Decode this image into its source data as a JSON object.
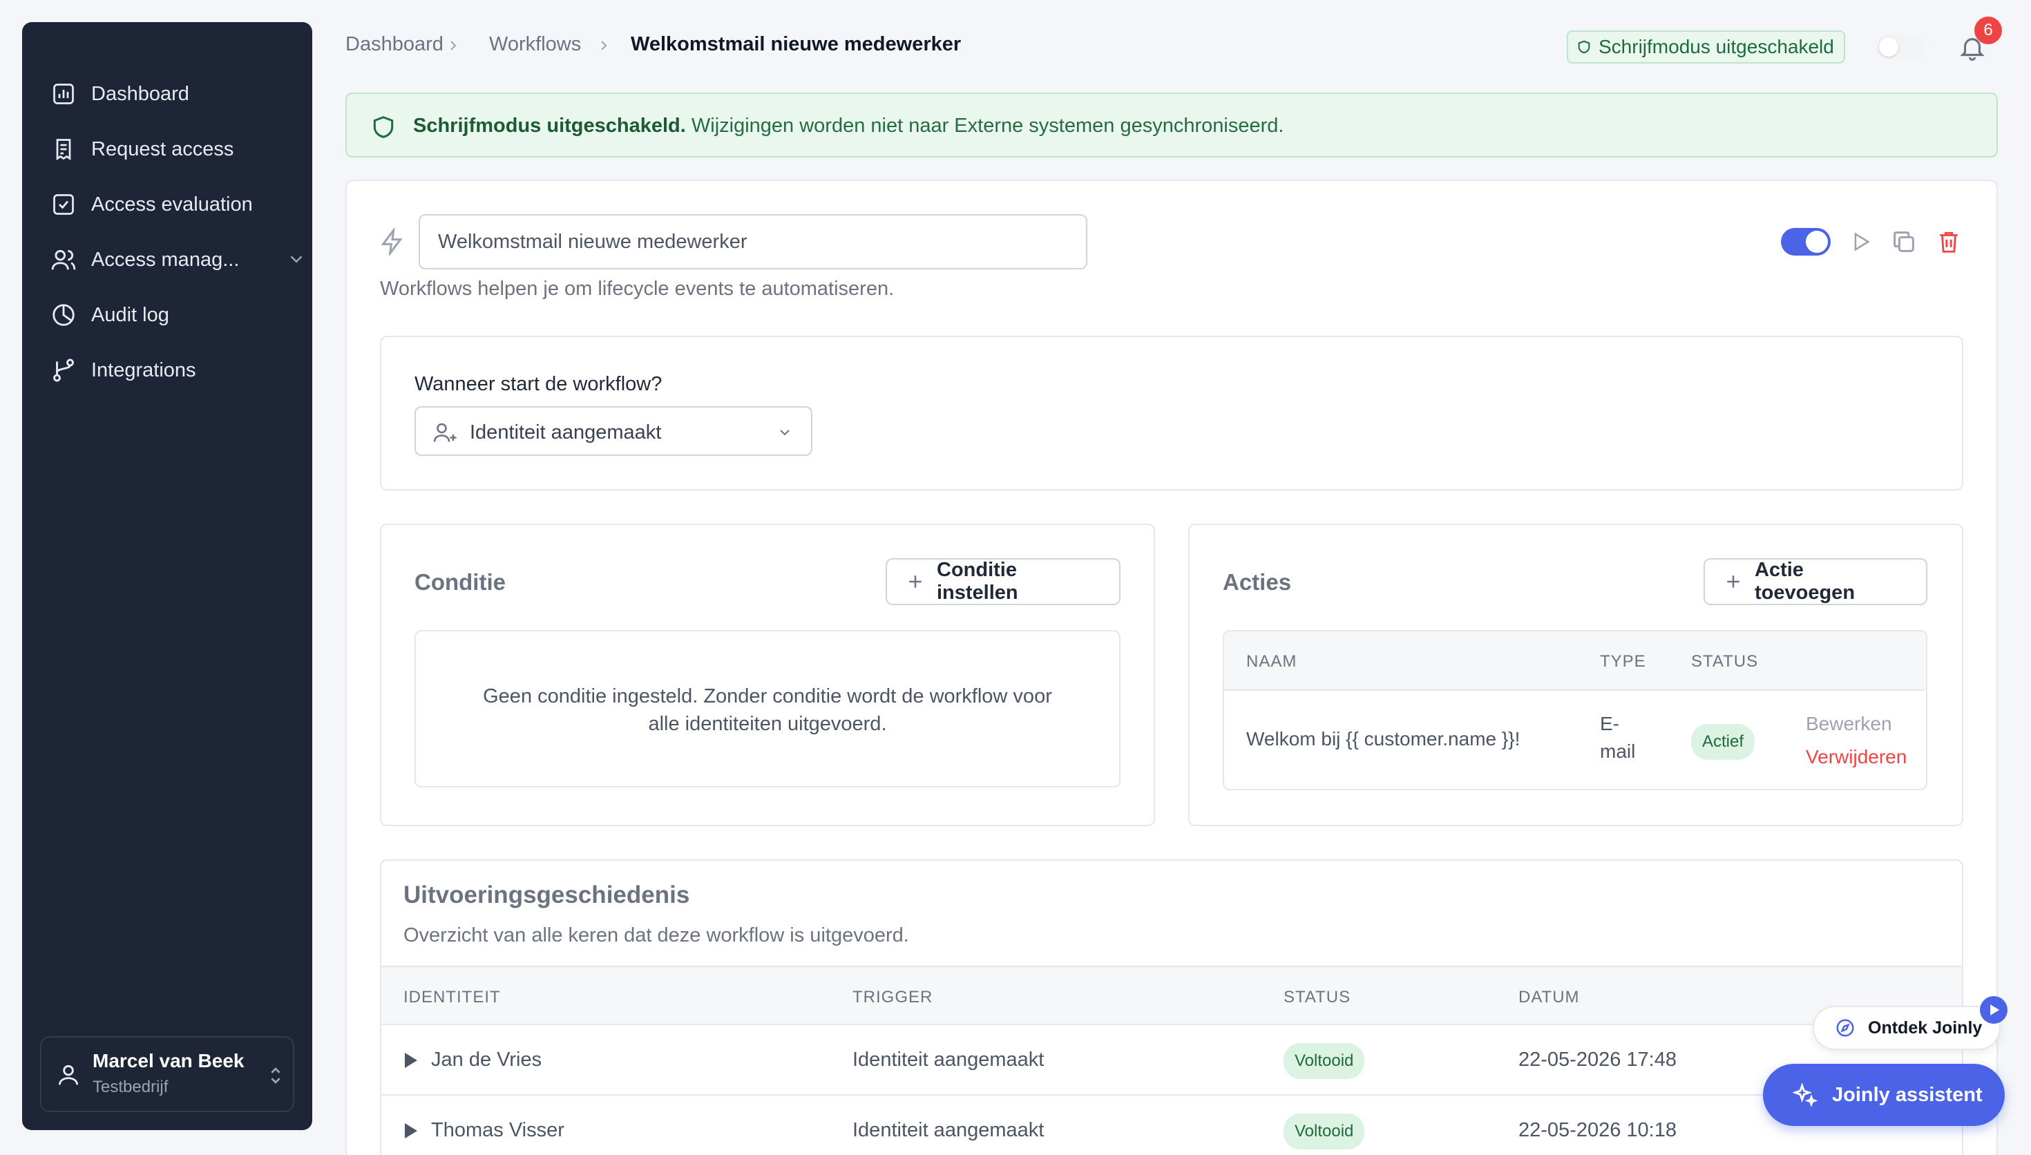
{
  "sidebar": {
    "items": [
      {
        "label": "Dashboard",
        "icon": "bar-chart-icon"
      },
      {
        "label": "Request access",
        "icon": "document-icon"
      },
      {
        "label": "Access evaluation",
        "icon": "checkbox-icon"
      },
      {
        "label": "Access manag...",
        "icon": "users-icon"
      },
      {
        "label": "Audit log",
        "icon": "pie-chart-icon"
      },
      {
        "label": "Integrations",
        "icon": "git-branch-icon"
      }
    ],
    "user": {
      "name": "Marcel van Beek",
      "org": "Testbedrijf"
    }
  },
  "header": {
    "breadcrumbs": [
      "Dashboard",
      "Workflows",
      "Welkomstmail nieuwe medewerker"
    ],
    "write_mode_badge": "Schrijfmodus uitgeschakeld",
    "notification_count": "6"
  },
  "banner": {
    "title": "Schrijfmodus uitgeschakeld.",
    "text": " Wijzigingen worden niet naar Externe systemen gesynchroniseerd."
  },
  "workflow": {
    "name": "Welkomstmail nieuwe medewerker",
    "description": "Workflows helpen je om lifecycle events te automatiseren.",
    "enabled": true,
    "trigger_label": "Wanneer start de workflow?",
    "trigger_value": "Identiteit aangemaakt"
  },
  "condition": {
    "title": "Conditie",
    "button": "Conditie instellen",
    "empty_line1": "Geen conditie ingesteld. Zonder conditie wordt de workflow voor",
    "empty_line2": "alle identiteiten uitgevoerd."
  },
  "actions": {
    "title": "Acties",
    "button": "Actie toevoegen",
    "columns": [
      "NAAM",
      "TYPE",
      "STATUS"
    ],
    "rows": [
      {
        "name": "Welkom bij {{ customer.name }}!",
        "type_line1": "E-",
        "type_line2": "mail",
        "status": "Actief",
        "edit": "Bewerken",
        "delete": "Verwijderen"
      }
    ]
  },
  "history": {
    "title": "Uitvoeringsgeschiedenis",
    "subtitle": "Overzicht van alle keren dat deze workflow is uitgevoerd.",
    "columns": [
      "IDENTITEIT",
      "TRIGGER",
      "STATUS",
      "DATUM"
    ],
    "rows": [
      {
        "identity": "Jan de Vries",
        "trigger": "Identiteit aangemaakt",
        "status": "Voltooid",
        "date": "22-05-2026 17:48"
      },
      {
        "identity": "Thomas Visser",
        "trigger": "Identiteit aangemaakt",
        "status": "Voltooid",
        "date": "22-05-2026 10:18"
      }
    ]
  },
  "floating": {
    "discover": "Ontdek Joinly",
    "assistant": "Joinly assistent"
  },
  "colors": {
    "sidebar_bg": "#1e2536",
    "accent": "#4a63e7",
    "success_bg": "#eaf7ef",
    "success_text": "#1e6b3e",
    "danger": "#ef4444"
  }
}
